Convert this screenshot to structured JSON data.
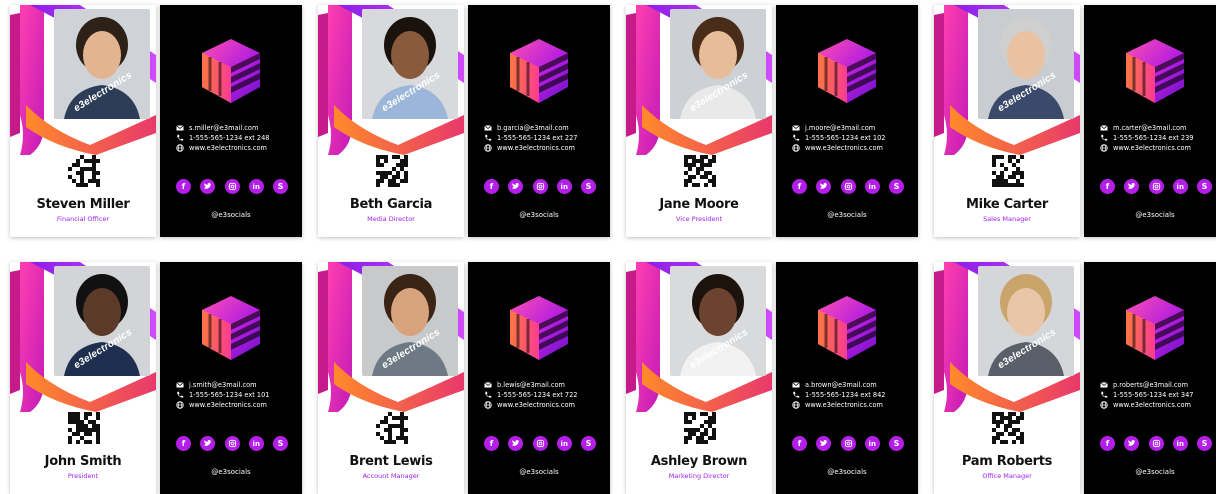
{
  "brand": {
    "tagline": "e3electronics",
    "website": "www.e3electronics.com",
    "phone_prefix": "1-555-565-1234",
    "handle": "@e3socials",
    "accent": "#b31ee8"
  },
  "social_icons": [
    "facebook-icon",
    "twitter-icon",
    "instagram-icon",
    "linkedin-icon",
    "skype-icon"
  ],
  "cards": [
    {
      "name": "Steven Miller",
      "role": "Financial Officer",
      "email": "s.miller@e3mail.com",
      "phone": "1-555-565-1234  ext 248",
      "website": "www.e3electronics.com",
      "handle": "@e3socials",
      "tagline": "e3electronics"
    },
    {
      "name": "Beth Garcia",
      "role": "Media Director",
      "email": "b.garcia@e3mail.com",
      "phone": "1-555-565-1234  ext 227",
      "website": "www.e3electronics.com",
      "handle": "@e3socials",
      "tagline": "e3electronics"
    },
    {
      "name": "Jane Moore",
      "role": "Vice President",
      "email": "j.moore@e3mail.com",
      "phone": "1-555-565-1234  ext 102",
      "website": "www.e3electronics.com",
      "handle": "@e3socials",
      "tagline": "e3electronics"
    },
    {
      "name": "Mike Carter",
      "role": "Sales Manager",
      "email": "m.carter@e3mail.com",
      "phone": "1-555-565-1234  ext 239",
      "website": "www.e3electronics.com",
      "handle": "@e3socials",
      "tagline": "e3electronics"
    },
    {
      "name": "John Smith",
      "role": "President",
      "email": "j.smith@e3mail.com",
      "phone": "1-555-565-1234  ext 101",
      "website": "www.e3electronics.com",
      "handle": "@e3socials",
      "tagline": "e3electronics"
    },
    {
      "name": "Brent Lewis",
      "role": "Account Manager",
      "email": "b.lewis@e3mail.com",
      "phone": "1-555-565-1234  ext 722",
      "website": "www.e3electronics.com",
      "handle": "@e3socials",
      "tagline": "e3electronics"
    },
    {
      "name": "Ashley Brown",
      "role": "Marketing Director",
      "email": "a.brown@e3mail.com",
      "phone": "1-555-565-1234  ext 842",
      "website": "www.e3electronics.com",
      "handle": "@e3socials",
      "tagline": "e3electronics"
    },
    {
      "name": "Pam Roberts",
      "role": "Office Manager",
      "email": "p.roberts@e3mail.com",
      "phone": "1-555-565-1234  ext 347",
      "website": "www.e3electronics.com",
      "handle": "@e3socials",
      "tagline": "e3electronics"
    }
  ]
}
